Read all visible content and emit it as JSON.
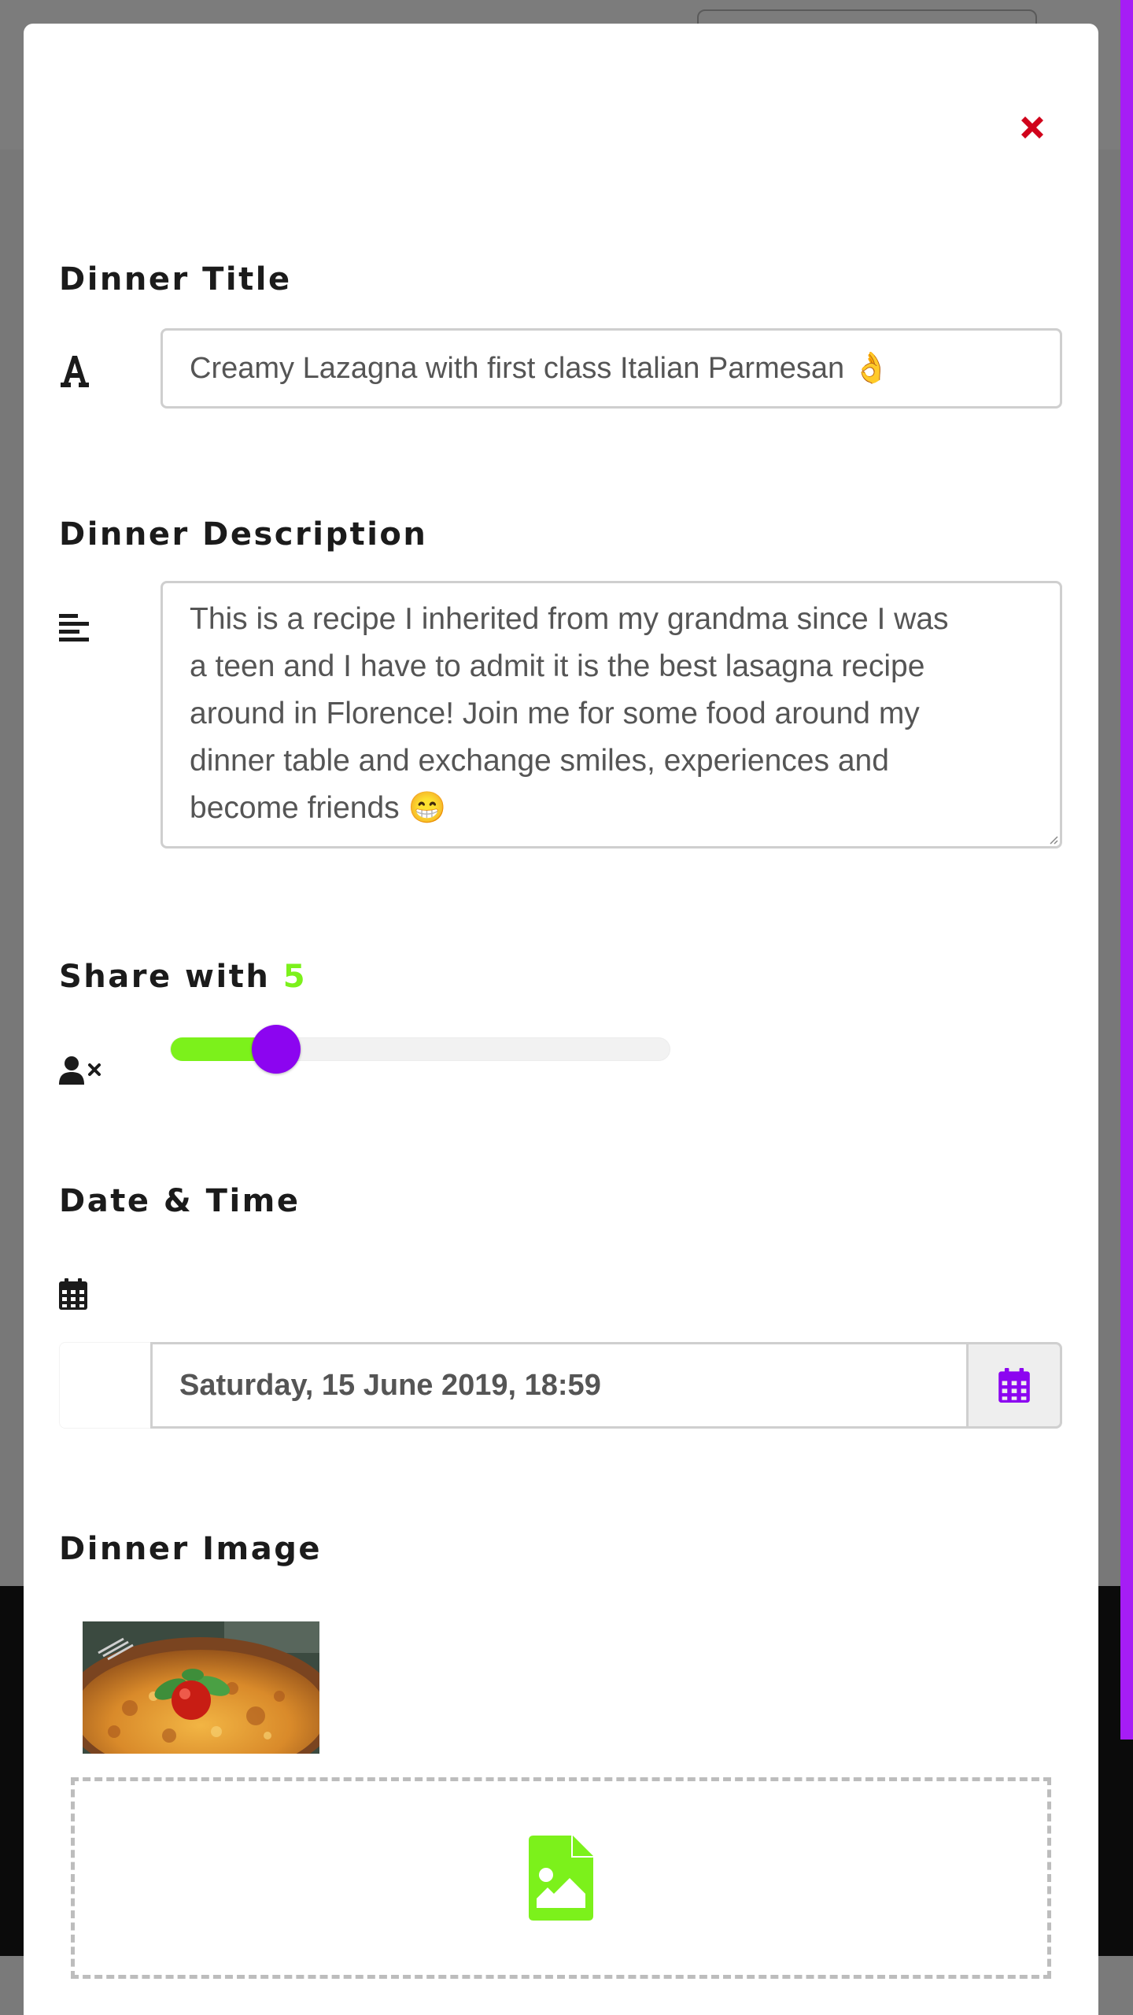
{
  "modal": {
    "close_icon": "close-icon",
    "close_color": "#d0021b"
  },
  "title_section": {
    "heading": "Dinner Title",
    "icon": "font-icon",
    "value": "Creamy Lazagna with first class Italian Parmesan 👌"
  },
  "description_section": {
    "heading": "Dinner Description",
    "icon": "align-left-icon",
    "lines": [
      "This is a recipe I inherited from my grandma since I was",
      "a teen and I have to admit it is the best lasagna recipe",
      "around in Florence! Join me for some food around my",
      "dinner table and exchange smiles, experiences and",
      "become friends 😁"
    ]
  },
  "share_section": {
    "heading": "Share with",
    "count": "5",
    "icon": "user-times-icon",
    "slider_fraction": 0.211,
    "accent_color": "#7cf11b",
    "thumb_color": "#8c05f0"
  },
  "date_section": {
    "heading": "Date & Time",
    "icon": "calendar-icon",
    "value": "Saturday, 15 June 2019, 18:59",
    "addon_icon": "calendar-icon",
    "addon_color": "#8c05f0"
  },
  "image_section": {
    "heading": "Dinner Image",
    "thumbnail": "lasagna-photo",
    "dropzone_icon": "file-image-icon",
    "dropzone_color": "#7cf11b"
  }
}
